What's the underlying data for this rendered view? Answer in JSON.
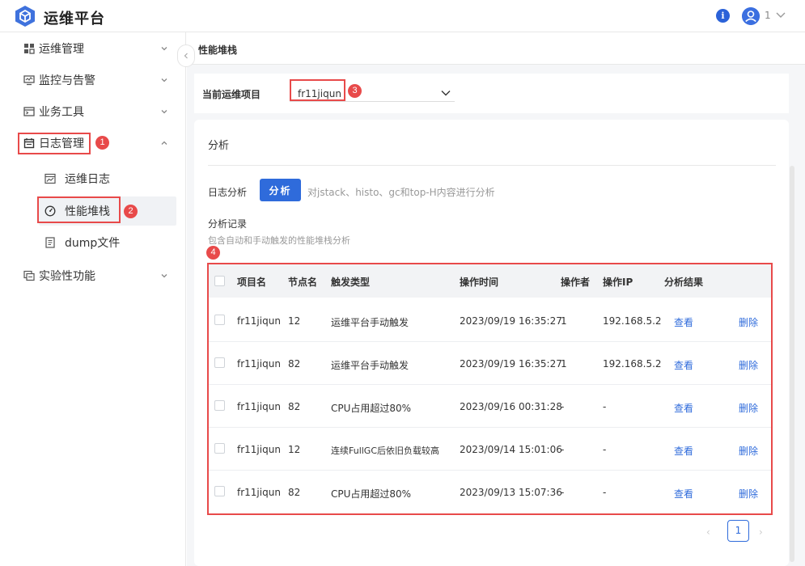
{
  "app": {
    "title": "运维平台"
  },
  "header": {
    "info_glyph": "i",
    "user_name": "1"
  },
  "sidebar": {
    "items": [
      {
        "label": "运维管理",
        "icon": "grid-icon"
      },
      {
        "label": "监控与告警",
        "icon": "monitor-icon"
      },
      {
        "label": "业务工具",
        "icon": "terminal-icon"
      },
      {
        "label": "日志管理",
        "icon": "calendar-icon",
        "expanded": true,
        "children": [
          {
            "label": "运维日志",
            "icon": "chart-icon"
          },
          {
            "label": "性能堆栈",
            "icon": "gauge-icon",
            "active": true
          },
          {
            "label": "dump文件",
            "icon": "file-icon"
          }
        ]
      },
      {
        "label": "实验性功能",
        "icon": "lab-icon"
      }
    ]
  },
  "annotations": [
    "1",
    "2",
    "3",
    "4"
  ],
  "breadcrumb": "性能堆栈",
  "project": {
    "label": "当前运维项目",
    "value": "fr11jiqun"
  },
  "analysis": {
    "title": "分析",
    "log_label": "日志分析",
    "button": "分析",
    "hint": "对jstack、histo、gc和top-H内容进行分析",
    "records_title": "分析记录",
    "records_desc": "包含自动和手动触发的性能堆栈分析"
  },
  "table": {
    "columns": [
      "项目名",
      "节点名",
      "触发类型",
      "操作时间",
      "操作者",
      "操作IP",
      "分析结果"
    ],
    "rows": [
      {
        "project": "fr11jiqun",
        "node": "12",
        "trigger": "运维平台手动触发",
        "time": "2023/09/19 16:35:27",
        "operator": "1",
        "ip": "192.168.5.2",
        "view": "查看",
        "delete": "删除"
      },
      {
        "project": "fr11jiqun",
        "node": "82",
        "trigger": "运维平台手动触发",
        "time": "2023/09/19 16:35:27",
        "operator": "1",
        "ip": "192.168.5.2",
        "view": "查看",
        "delete": "删除"
      },
      {
        "project": "fr11jiqun",
        "node": "82",
        "trigger": "CPU占用超过80%",
        "time": "2023/09/16 00:31:28",
        "operator": "-",
        "ip": "-",
        "view": "查看",
        "delete": "删除"
      },
      {
        "project": "fr11jiqun",
        "node": "12",
        "trigger": "连续FullGC后依旧负载较高",
        "time": "2023/09/14 15:01:06",
        "operator": "-",
        "ip": "-",
        "view": "查看",
        "delete": "删除"
      },
      {
        "project": "fr11jiqun",
        "node": "82",
        "trigger": "CPU占用超过80%",
        "time": "2023/09/13 15:07:36",
        "operator": "-",
        "ip": "-",
        "view": "查看",
        "delete": "删除"
      }
    ]
  },
  "pagination": {
    "current": "1",
    "prev_glyph": "‹",
    "next_glyph": "›"
  },
  "colors": {
    "primary": "#2f6bdb",
    "annotation": "#e84a4a"
  }
}
